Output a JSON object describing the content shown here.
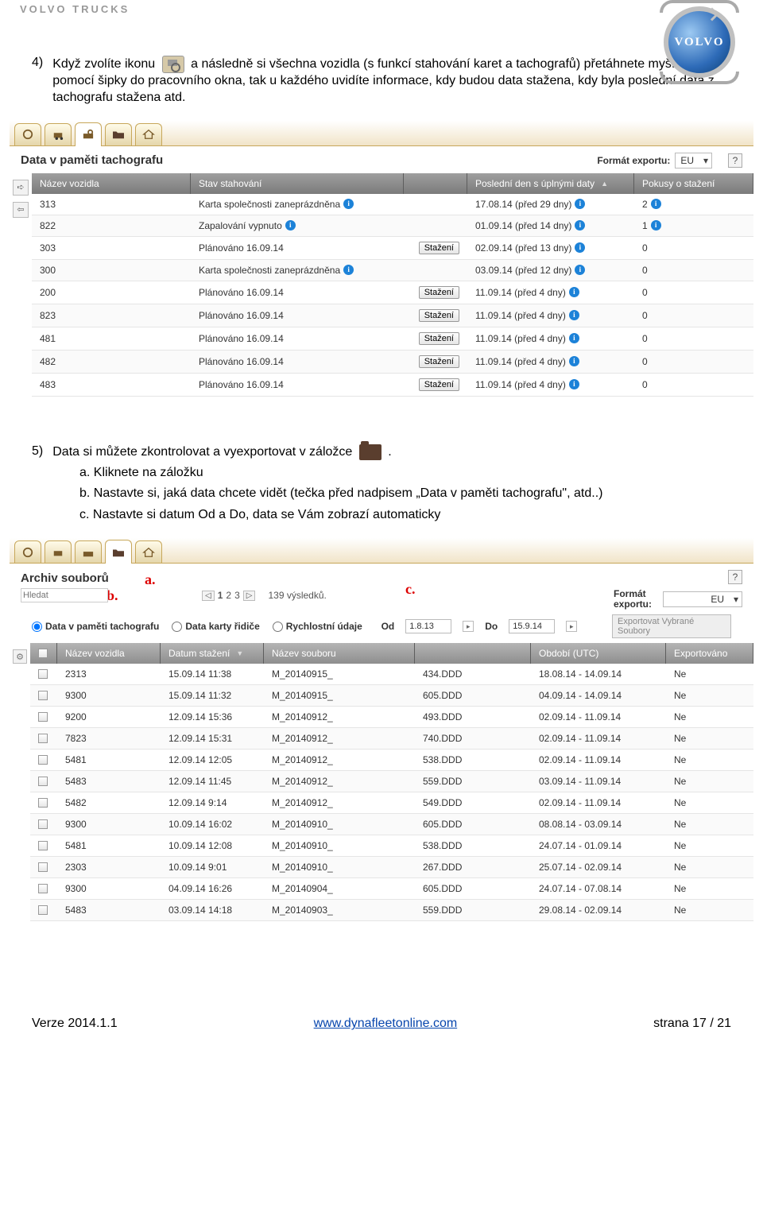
{
  "brand": "VOLVO TRUCKS",
  "logo_text": "VOLVO",
  "item4_num": "4)",
  "item4_before": "Když zvolíte ikonu",
  "item4_after": "a následně si všechna vozidla (s funkcí stahování karet a tachografů) přetáhnete myší nebo pomocí šipky do pracovního okna, tak u každého uvidíte informace, kdy budou data stažena, kdy byla poslední data z tachografu stažena atd.",
  "shot1": {
    "title": "Data v paměti tachografu",
    "export_label": "Formát exportu:",
    "export_value": "EU",
    "headers": [
      "Název vozidla",
      "Stav stahování",
      "",
      "Poslední den s úplnými daty",
      "Pokusy o stažení"
    ],
    "btn_download": "Stažení",
    "rows": [
      {
        "name": "313",
        "status": "Karta společnosti zaneprázdněna",
        "status_info": true,
        "btn": false,
        "last": "17.08.14 (před 29 dny)",
        "last_info": true,
        "att": "2",
        "att_info": true
      },
      {
        "name": "822",
        "status": "Zapalování vypnuto",
        "status_info": true,
        "btn": false,
        "last": "01.09.14 (před 14 dny)",
        "last_info": true,
        "att": "1",
        "att_info": true
      },
      {
        "name": "303",
        "status": "Plánováno 16.09.14",
        "status_info": false,
        "btn": true,
        "last": "02.09.14 (před 13 dny)",
        "last_info": true,
        "att": "0",
        "att_info": false
      },
      {
        "name": "300",
        "status": "Karta společnosti zaneprázdněna",
        "status_info": true,
        "btn": false,
        "last": "03.09.14 (před 12 dny)",
        "last_info": true,
        "att": "0",
        "att_info": false
      },
      {
        "name": "200",
        "status": "Plánováno 16.09.14",
        "status_info": false,
        "btn": true,
        "last": "11.09.14 (před 4 dny)",
        "last_info": true,
        "att": "0",
        "att_info": false
      },
      {
        "name": "823",
        "status": "Plánováno 16.09.14",
        "status_info": false,
        "btn": true,
        "last": "11.09.14 (před 4 dny)",
        "last_info": true,
        "att": "0",
        "att_info": false
      },
      {
        "name": "481",
        "status": "Plánováno 16.09.14",
        "status_info": false,
        "btn": true,
        "last": "11.09.14 (před 4 dny)",
        "last_info": true,
        "att": "0",
        "att_info": false
      },
      {
        "name": "482",
        "status": "Plánováno 16.09.14",
        "status_info": false,
        "btn": true,
        "last": "11.09.14 (před 4 dny)",
        "last_info": true,
        "att": "0",
        "att_info": false
      },
      {
        "name": "483",
        "status": "Plánováno 16.09.14",
        "status_info": false,
        "btn": true,
        "last": "11.09.14 (před 4 dny)",
        "last_info": true,
        "att": "0",
        "att_info": false
      }
    ]
  },
  "item5_num": "5)",
  "item5_before": "Data si můžete zkontrolovat a vyexportovat v záložce",
  "item5_after": ".",
  "sub_a_label": "a.  Kliknete na záložku",
  "sub_b_label": "b.  Nastavte si, jaká data chcete vidět (tečka před nadpisem „Data v paměti tachografu\", atd..)",
  "sub_c_label": "c.  Nastavte si datum Od a Do, data se Vám zobrazí automaticky",
  "ann_a": "a.",
  "ann_b": "b.",
  "ann_c": "c.",
  "shot2": {
    "title": "Archiv souborů",
    "search_placeholder": "Hledat",
    "pages": [
      "1",
      "2",
      "3"
    ],
    "results": "139 výsledků.",
    "radios": [
      "Data v paměti tachografu",
      "Data karty řidiče",
      "Rychlostní údaje"
    ],
    "od": "Od",
    "do": "Do",
    "od_val": "1.8.13",
    "do_val": "15.9.14",
    "export_label": "Formát exportu:",
    "export_value": "EU",
    "export_btn": "Exportovat Vybrané Soubory",
    "headers": [
      "",
      "Název vozidla",
      "Datum stažení",
      "Název souboru",
      "",
      "Období (UTC)",
      "Exportováno"
    ],
    "rows": [
      {
        "n": "2313",
        "d": "15.09.14 11:38",
        "f": "M_20140915_",
        "ext": "434.DDD",
        "p": "18.08.14 - 14.09.14",
        "e": "Ne"
      },
      {
        "n": "9300",
        "d": "15.09.14 11:32",
        "f": "M_20140915_",
        "ext": "605.DDD",
        "p": "04.09.14 - 14.09.14",
        "e": "Ne"
      },
      {
        "n": "9200",
        "d": "12.09.14 15:36",
        "f": "M_20140912_",
        "ext": "493.DDD",
        "p": "02.09.14 - 11.09.14",
        "e": "Ne"
      },
      {
        "n": "7823",
        "d": "12.09.14 15:31",
        "f": "M_20140912_",
        "ext": "740.DDD",
        "p": "02.09.14 - 11.09.14",
        "e": "Ne"
      },
      {
        "n": "5481",
        "d": "12.09.14 12:05",
        "f": "M_20140912_",
        "ext": "538.DDD",
        "p": "02.09.14 - 11.09.14",
        "e": "Ne"
      },
      {
        "n": "5483",
        "d": "12.09.14 11:45",
        "f": "M_20140912_",
        "ext": "559.DDD",
        "p": "03.09.14 - 11.09.14",
        "e": "Ne"
      },
      {
        "n": "5482",
        "d": "12.09.14 9:14",
        "f": "M_20140912_",
        "ext": "549.DDD",
        "p": "02.09.14 - 11.09.14",
        "e": "Ne"
      },
      {
        "n": "9300",
        "d": "10.09.14 16:02",
        "f": "M_20140910_",
        "ext": "605.DDD",
        "p": "08.08.14 - 03.09.14",
        "e": "Ne"
      },
      {
        "n": "5481",
        "d": "10.09.14 12:08",
        "f": "M_20140910_",
        "ext": "538.DDD",
        "p": "24.07.14 - 01.09.14",
        "e": "Ne"
      },
      {
        "n": "2303",
        "d": "10.09.14 9:01",
        "f": "M_20140910_",
        "ext": "267.DDD",
        "p": "25.07.14 - 02.09.14",
        "e": "Ne"
      },
      {
        "n": "9300",
        "d": "04.09.14 16:26",
        "f": "M_20140904_",
        "ext": "605.DDD",
        "p": "24.07.14 - 07.08.14",
        "e": "Ne"
      },
      {
        "n": "5483",
        "d": "03.09.14 14:18",
        "f": "M_20140903_",
        "ext": "559.DDD",
        "p": "29.08.14 - 02.09.14",
        "e": "Ne"
      }
    ]
  },
  "footer": {
    "left": "Verze 2014.1.1",
    "mid": "www.dynafleetonline.com",
    "right": "strana 17 / 21"
  }
}
